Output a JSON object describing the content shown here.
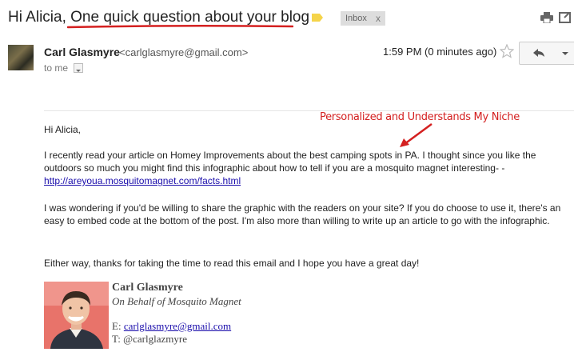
{
  "subject": {
    "prefix": "Hi Alicia,",
    "question": "One quick question about your blog"
  },
  "label_chip": {
    "label": "Inbox",
    "close": "x"
  },
  "sender": {
    "name": "Carl Glasmyre",
    "email": "<carlglasmyre@gmail.com>",
    "to": "to me",
    "time": "1:59 PM (0 minutes ago)"
  },
  "annotation": {
    "text": "Personalized and Understands My Niche",
    "color": "#d42020"
  },
  "message": {
    "greeting": "Hi Alicia,",
    "p1_text": "I recently read your article on Homey Improvements about the best camping spots in PA. I thought since you like the outdoors so much you might find this infographic about how to tell if you are a mosquito magnet interesting- - ",
    "p1_link": "http://areyoua.mosquitomagnet.com/facts.html",
    "p2": "I was wondering if you'd be willing to share the graphic with the readers on your site? If you do choose to use it, there's an easy to embed code at the bottom of the post. I'm also more than willing to write up an article to go with the infographic.",
    "p3": "Either way, thanks for taking the time to read this email and I hope you have a great day!"
  },
  "signature": {
    "name": "Carl Glasmyre",
    "behalf": "On Behalf of Mosquito Magnet",
    "email_label": "E: ",
    "email": "carlglasmyre@gmail.com",
    "twitter": "T: @carlglazmyre"
  },
  "icons": {
    "tag": "label-tag-icon",
    "print": "print-icon",
    "new_window": "new-window-icon",
    "star": "star-icon",
    "reply": "reply-arrow-icon",
    "more": "chevron-down-icon"
  },
  "colors": {
    "link": "#1a0dab",
    "underline": "#d42020",
    "tag": "#f5d44a"
  }
}
